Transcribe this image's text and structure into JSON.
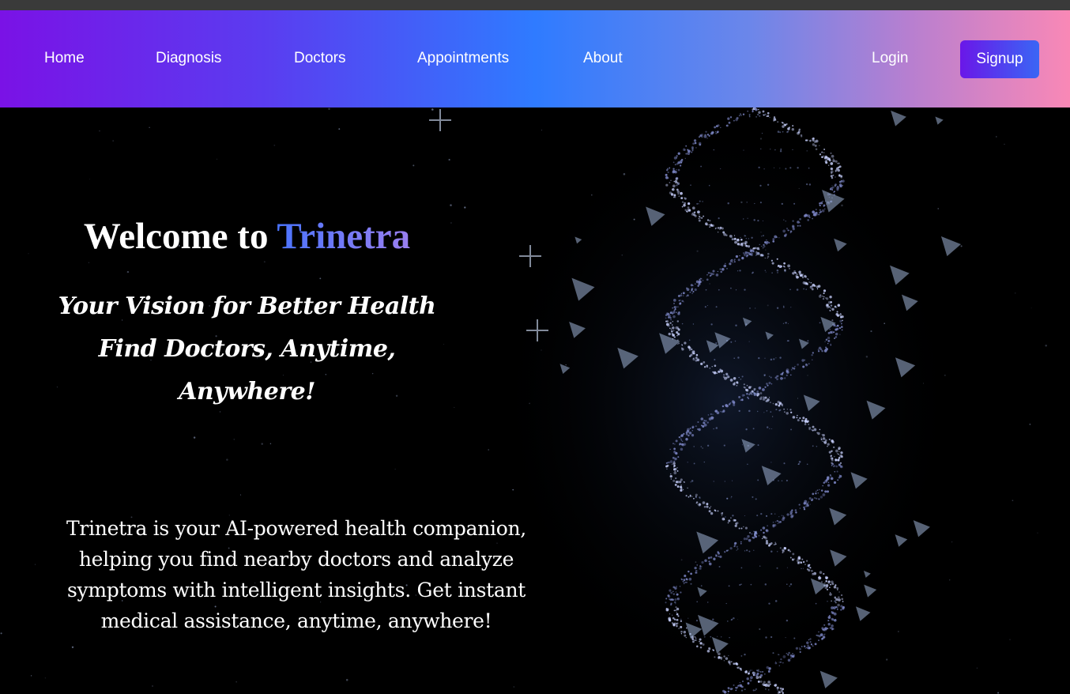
{
  "nav": {
    "links": [
      "Home",
      "Diagnosis",
      "Doctors",
      "Appointments",
      "About"
    ],
    "login_label": "Login",
    "signup_label": "Signup"
  },
  "hero": {
    "welcome_prefix": "Welcome to ",
    "brand": "Trinetra",
    "tagline_lines": [
      "Your Vision for Better Health",
      "Find Doctors, Anytime,",
      "Anywhere!"
    ],
    "description_lines": [
      "Trinetra is your AI-powered health companion,",
      "helping you find nearby doctors and analyze",
      "symptoms with intelligent insights. Get instant",
      "medical assistance, anytime, anywhere!"
    ],
    "background_image": "dna-helix-particles"
  },
  "colors": {
    "nav_gradient_start": "#7a12e6",
    "nav_gradient_mid": "#2f7bff",
    "nav_gradient_end": "#f988b6",
    "brand_gradient_start": "#4a74ff",
    "brand_gradient_end": "#9a7ff0",
    "hero_background": "#000000"
  }
}
